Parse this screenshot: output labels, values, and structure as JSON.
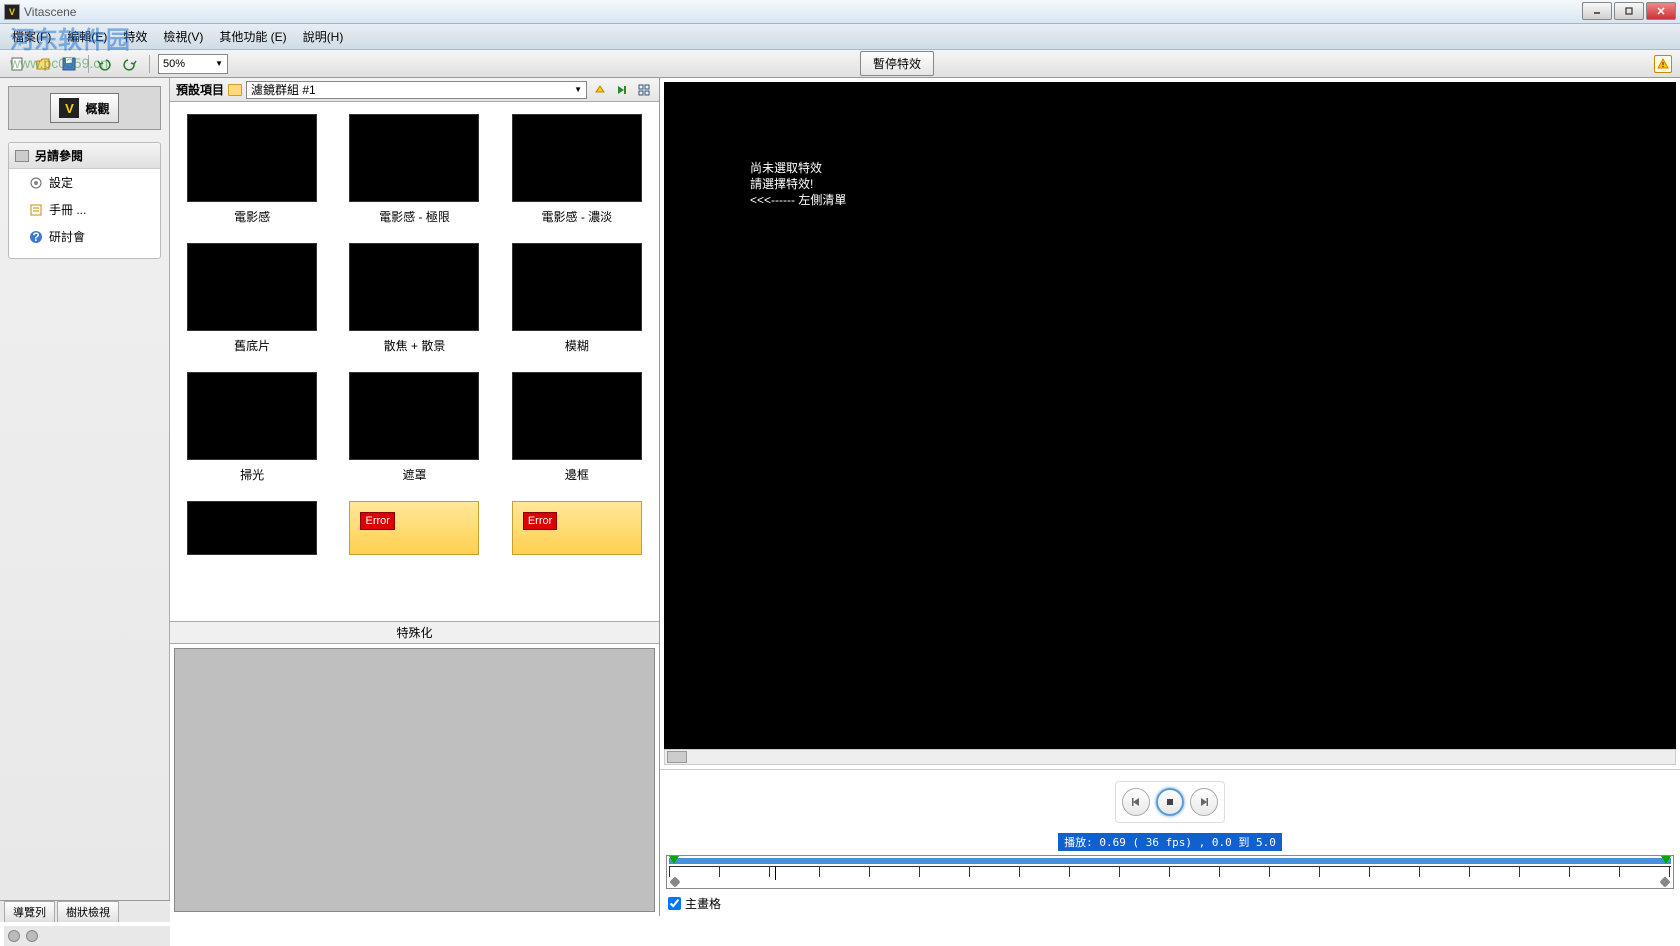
{
  "titlebar": {
    "app_icon_text": "V",
    "title": "Vitascene"
  },
  "window_controls": {
    "min": "_",
    "max": "□",
    "close": "✕"
  },
  "menu": {
    "file": "檔案(F)",
    "edit": "編輯(E)",
    "effect": "特效",
    "view": "檢視(V)",
    "other": "其他功能 (E)",
    "help": "說明(H)"
  },
  "toolbar": {
    "zoom": "50%",
    "pause_effect": "暫停特效"
  },
  "sidebar": {
    "overview_btn": "概觀",
    "see_also_header": "另請參閱",
    "items": [
      {
        "icon": "gear",
        "label": "設定"
      },
      {
        "icon": "book",
        "label": "手冊 ..."
      },
      {
        "icon": "help",
        "label": "研討會"
      }
    ]
  },
  "presets": {
    "label": "預設項目",
    "group_name": "濾鏡群組 #1",
    "items": [
      {
        "name": "電影感",
        "kind": "black"
      },
      {
        "name": "電影感 - 極限",
        "kind": "black"
      },
      {
        "name": "電影感 - 濃淡",
        "kind": "black"
      },
      {
        "name": "舊底片",
        "kind": "black"
      },
      {
        "name": "散焦 + 散景",
        "kind": "black"
      },
      {
        "name": "模糊",
        "kind": "black"
      },
      {
        "name": "掃光",
        "kind": "black"
      },
      {
        "name": "遮罩",
        "kind": "black"
      },
      {
        "name": "邊框",
        "kind": "black"
      },
      {
        "name": "",
        "kind": "black",
        "cut": true
      },
      {
        "name": "",
        "kind": "error",
        "cut": true
      },
      {
        "name": "",
        "kind": "error",
        "cut": true
      }
    ],
    "selection_label": "特殊化",
    "error_text": "Error"
  },
  "preview": {
    "line1": "尚未選取特效",
    "line2": "請選擇特效!",
    "line3": "<<<------  左側清單"
  },
  "playback": {
    "status": "播放: 0.69 ( 36    fps) ,  0.0 到  5.0"
  },
  "keyframe": {
    "checkbox_label": "主畫格"
  },
  "bottom_tabs": {
    "tab1": "導覽列",
    "tab2": "樹狀檢視"
  },
  "watermark": {
    "line1": "河东软件园",
    "line2": "www.pc0359.cn"
  }
}
